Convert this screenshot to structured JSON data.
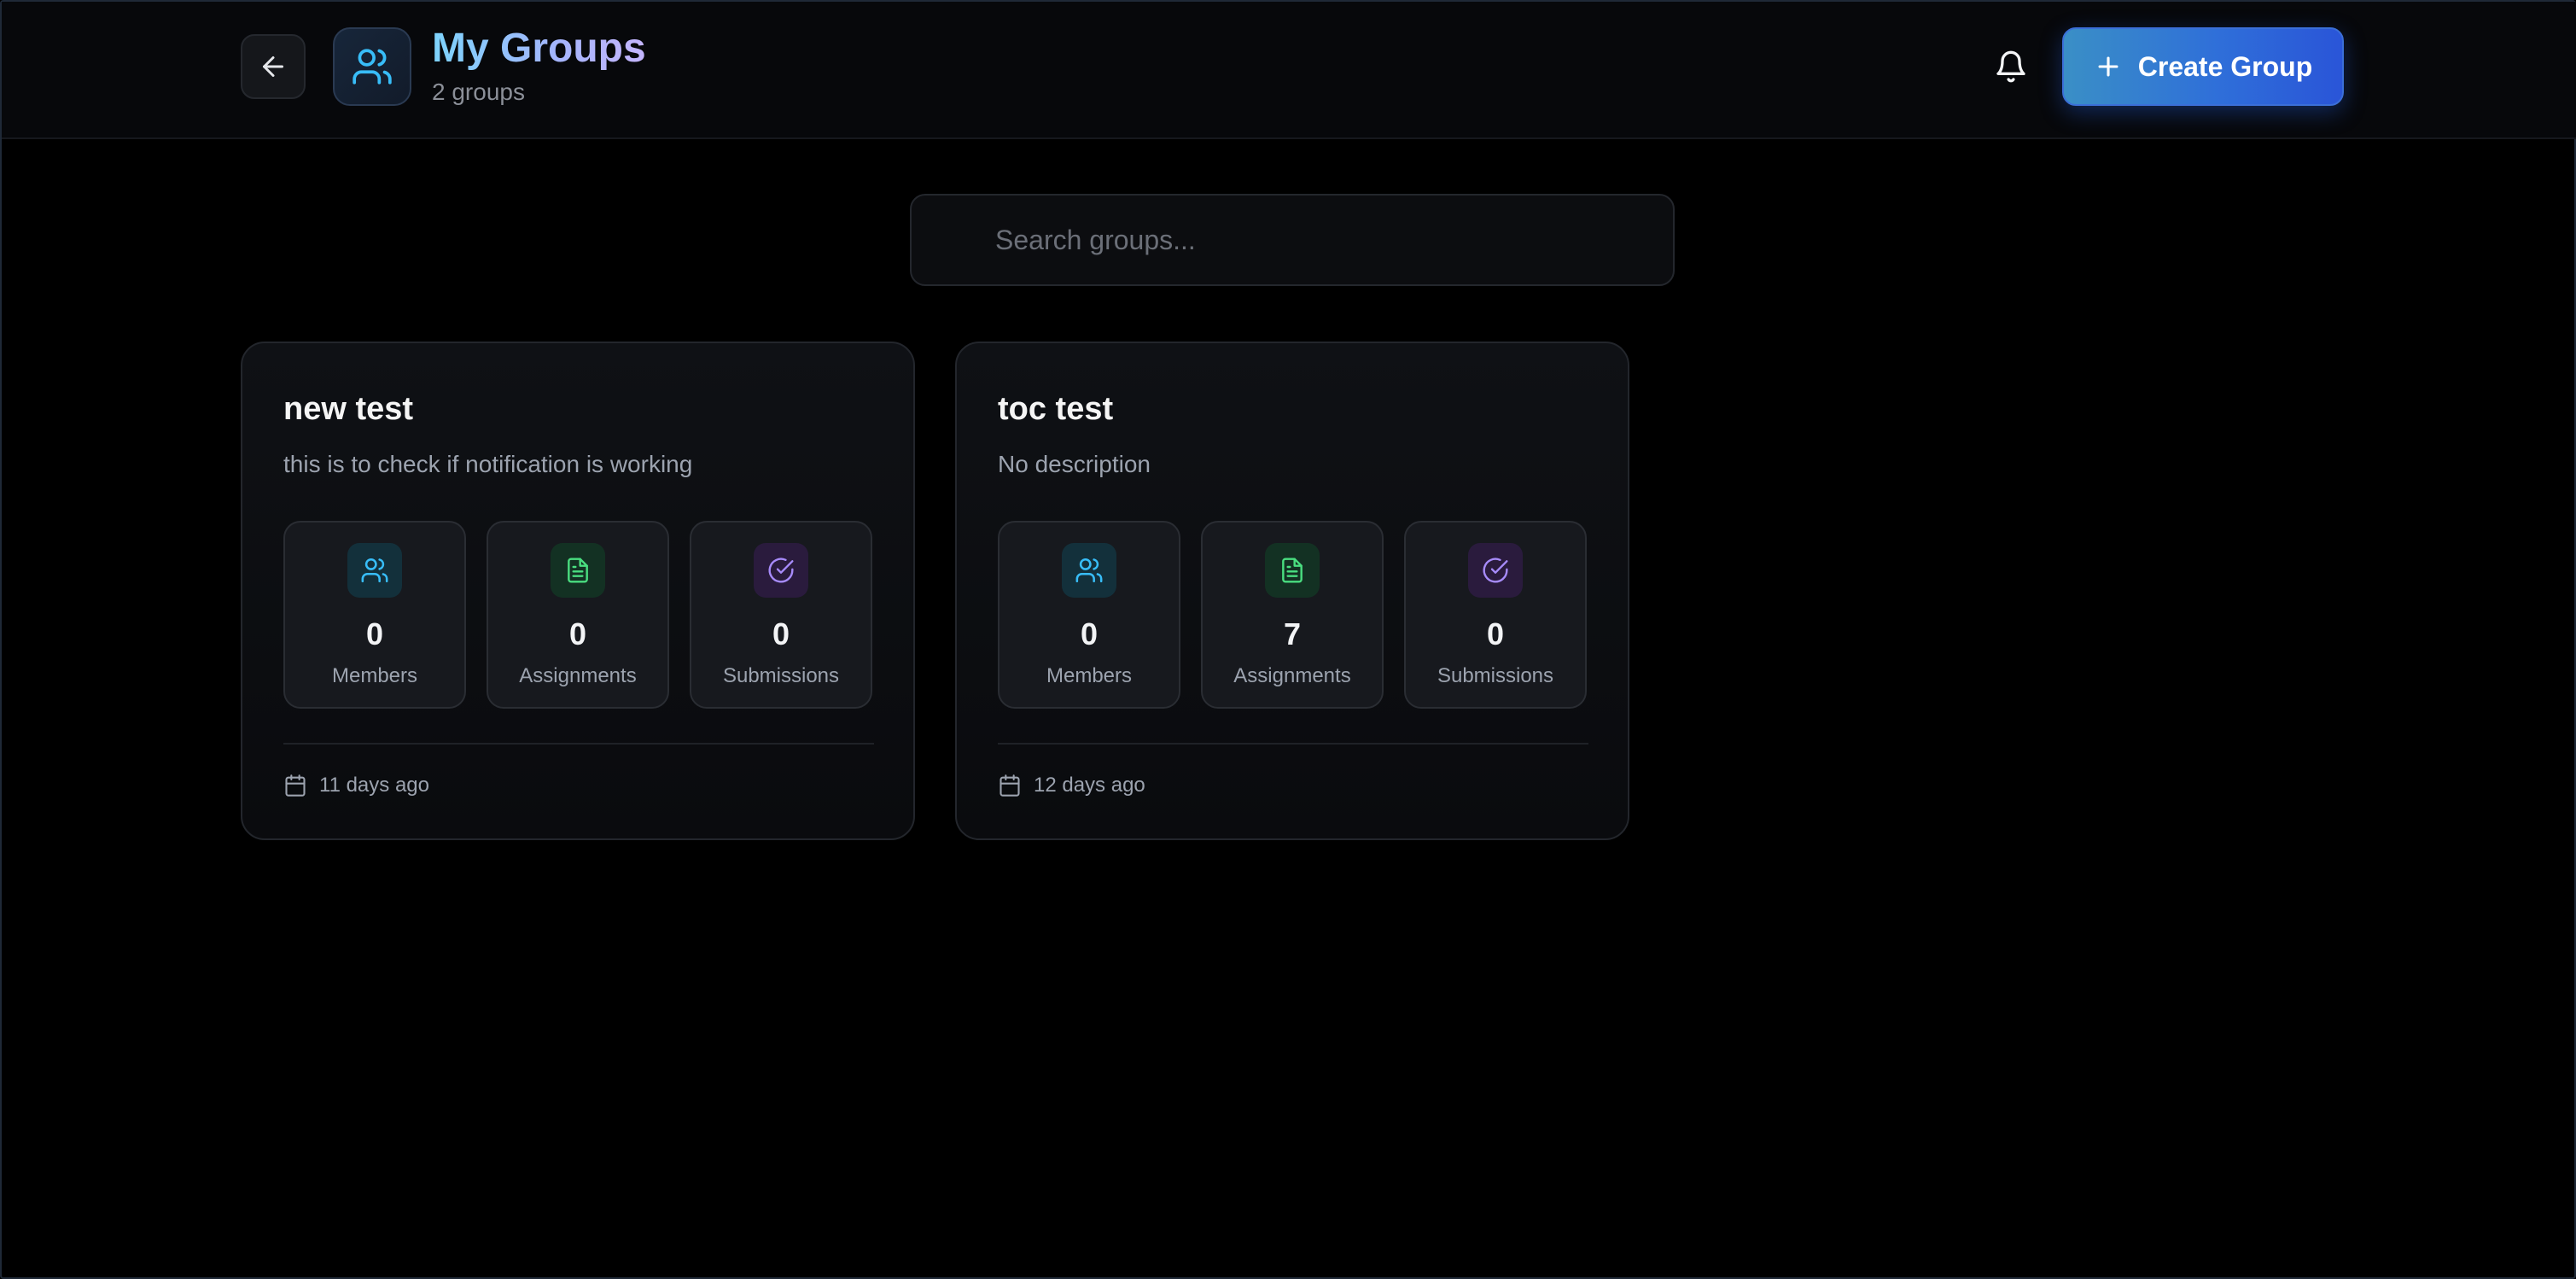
{
  "header": {
    "title": "My Groups",
    "subtitle": "2 groups",
    "create_label": "Create Group",
    "back_icon": "arrow-left-icon",
    "app_icon": "users-icon",
    "bell_icon": "bell-icon"
  },
  "search": {
    "placeholder": "Search groups...",
    "value": ""
  },
  "groups": [
    {
      "name": "new test",
      "description": "this is to check if notification is working",
      "stats": [
        {
          "value": "0",
          "label": "Members",
          "icon": "users-icon"
        },
        {
          "value": "0",
          "label": "Assignments",
          "icon": "document-icon"
        },
        {
          "value": "0",
          "label": "Submissions",
          "icon": "check-circle-icon"
        }
      ],
      "created": "11 days ago"
    },
    {
      "name": "toc test",
      "description": "No description",
      "stats": [
        {
          "value": "0",
          "label": "Members",
          "icon": "users-icon"
        },
        {
          "value": "7",
          "label": "Assignments",
          "icon": "document-icon"
        },
        {
          "value": "0",
          "label": "Submissions",
          "icon": "check-circle-icon"
        }
      ],
      "created": "12 days ago"
    }
  ],
  "colors": {
    "accent": "#2f6fd9",
    "members": "#38bdf8",
    "assignments": "#4ade80",
    "submissions": "#a78bfa"
  }
}
